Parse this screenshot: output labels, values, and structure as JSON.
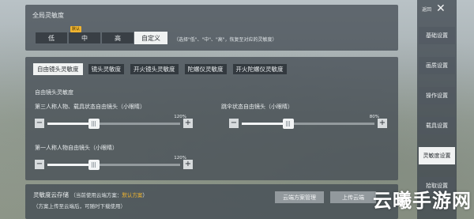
{
  "global": {
    "title": "全局灵敏度",
    "options": [
      {
        "label": "低",
        "active": false,
        "badge": ""
      },
      {
        "label": "中",
        "active": false,
        "badge": "默认"
      },
      {
        "label": "高",
        "active": false,
        "badge": ""
      },
      {
        "label": "自定义",
        "active": true,
        "badge": ""
      }
    ],
    "hint": "（选择\"低\"、\"中\"、\"高\"，恢复至对应的灵敏度）"
  },
  "tabs": [
    {
      "label": "自由镜头灵敏度",
      "active": true
    },
    {
      "label": "镜头灵敏度",
      "active": false
    },
    {
      "label": "开火镜头灵敏度",
      "active": false
    },
    {
      "label": "陀螺仪灵敏度",
      "active": false
    },
    {
      "label": "开火陀螺仪灵敏度",
      "active": false
    }
  ],
  "lens": {
    "subtitle": "自由镜头灵敏度",
    "sliders": [
      {
        "label": "第三人称人物、载具状态自由镜头（小眼睛）",
        "max": "120%",
        "value": 0.35
      },
      {
        "label": "跳伞状态自由镜头（小眼睛）",
        "max": "80%",
        "value": 0.35
      },
      {
        "label": "第一人称人物自由镜头（小眼睛）",
        "max": "120%",
        "value": 0.35
      }
    ],
    "minus": "−",
    "plus": "+"
  },
  "cloud": {
    "title": "灵敏度云存储",
    "current": "（当前使用云端方案：",
    "plan": "默认方案",
    "current_end": "）",
    "desc": "（方案上传至云端后，可随时下载使用）",
    "manage_btn": "云端方案管理",
    "upload_btn": "上传云端"
  },
  "sidebar": {
    "return_label": "返回",
    "close_icon": "close-icon",
    "items": [
      {
        "label": "基础设置",
        "active": false
      },
      {
        "label": "画质设置",
        "active": false
      },
      {
        "label": "操作设置",
        "active": false
      },
      {
        "label": "载具设置",
        "active": false
      },
      {
        "label": "灵敏度设置",
        "active": true
      },
      {
        "label": "拾取设置",
        "active": false
      }
    ]
  },
  "watermark": "云曦手游网",
  "colors": {
    "accent": "#f0b430",
    "active_bg": "#f0f2f2"
  }
}
